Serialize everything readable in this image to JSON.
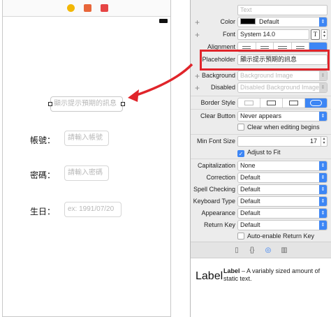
{
  "canvas": {
    "placeholder_field": "顯示提示預期的訊息",
    "labels": {
      "account": "帳號：",
      "password": "密碼：",
      "birthday": "生日："
    },
    "fields": {
      "account_placeholder": "請輸入帳號",
      "password_placeholder": "請輸入密碼",
      "birthday_placeholder": "ex: 1991/07/20"
    }
  },
  "inspector": {
    "text_placeholder": "Text",
    "color": {
      "label": "Color",
      "value": "Default"
    },
    "font": {
      "label": "Font",
      "value": "System 14.0"
    },
    "alignment": {
      "label": "Alignment"
    },
    "placeholder": {
      "label": "Placeholder",
      "value": "顯示提示預期的訊息"
    },
    "background": {
      "label": "Background",
      "value": "Background Image"
    },
    "disabled": {
      "label": "Disabled",
      "value": "Disabled Background Image"
    },
    "border_style": {
      "label": "Border Style"
    },
    "clear_button": {
      "label": "Clear Button",
      "value": "Never appears"
    },
    "clear_when_editing": "Clear when editing begins",
    "min_font_size": {
      "label": "Min Font Size",
      "value": "17"
    },
    "adjust_to_fit": "Adjust to Fit",
    "capitalization": {
      "label": "Capitalization",
      "value": "None"
    },
    "correction": {
      "label": "Correction",
      "value": "Default"
    },
    "spell_checking": {
      "label": "Spell Checking",
      "value": "Default"
    },
    "keyboard_type": {
      "label": "Keyboard Type",
      "value": "Default"
    },
    "appearance": {
      "label": "Appearance",
      "value": "Default"
    },
    "return_key": {
      "label": "Return Key",
      "value": "Default"
    },
    "auto_enable_return_key": "Auto-enable Return Key"
  },
  "library": {
    "item_title": "Label",
    "item_name": "Label",
    "item_desc": " – A variably sized amount of static text."
  },
  "colors": {
    "accent": "#3d86f5",
    "highlight": "#e0242a"
  },
  "icons": [
    "file-icon",
    "braces-icon",
    "circle-icon",
    "ruler-icon",
    "font-icon",
    "arrow-icon"
  ]
}
